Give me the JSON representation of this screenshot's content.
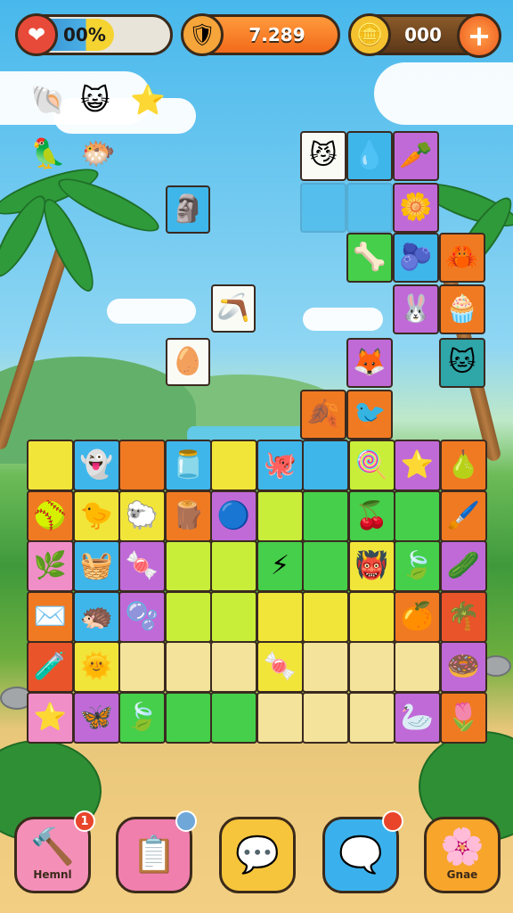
{
  "hud": {
    "progress": {
      "text": "00%",
      "fill_fraction": 0.62,
      "icon": "heart-icon"
    },
    "score": {
      "text": "7.289",
      "icon": "crest-icon"
    },
    "coins": {
      "text": "000",
      "icon": "coin-icon",
      "plus_symbol": "+"
    }
  },
  "colors": {
    "yellow": "#f2e53a",
    "lime": "#c8ee3a",
    "green": "#46cf4a",
    "orange": "#f07a22",
    "red": "#e9542a",
    "blue": "#3fb6ea",
    "purple": "#c06ad8",
    "pink": "#f08ec8",
    "white": "#fbfbf6",
    "sand": "#f4e39a",
    "teal": "#2fa6a8"
  },
  "floaters": [
    {
      "glyph": "🐚",
      "name": "shell-icon"
    },
    {
      "glyph": "😺",
      "name": "cat-face-icon"
    },
    {
      "glyph": "⭐",
      "name": "star-icon"
    },
    {
      "glyph": "🦜",
      "name": "parrot-icon"
    },
    {
      "glyph": "🐡",
      "name": "pufferfish-icon"
    }
  ],
  "falling_tiles": [
    {
      "glyph": "🗿",
      "color": "blue",
      "name": "moai-icon"
    },
    {
      "glyph": "🪃",
      "color": "white",
      "name": "boomerang-icon"
    },
    {
      "glyph": "🥚",
      "color": "white",
      "name": "egg-icon"
    }
  ],
  "stack_tiles": [
    {
      "glyph": "😼",
      "color": "white",
      "name": "cat-icon"
    },
    {
      "glyph": "💧",
      "color": "blue",
      "name": "drop-icon"
    },
    {
      "glyph": "🥕",
      "color": "purple",
      "name": "carrot-icon"
    },
    {
      "glyph": "",
      "color": "blue",
      "name": "empty-tile"
    },
    {
      "glyph": "",
      "color": "blue",
      "name": "empty-tile"
    },
    {
      "glyph": "🌼",
      "color": "purple",
      "name": "flower-icon"
    },
    {
      "glyph": "🦴",
      "color": "green",
      "name": "bone-icon"
    },
    {
      "glyph": "🫐",
      "color": "blue",
      "name": "berry-icon"
    },
    {
      "glyph": "🦀",
      "color": "orange",
      "name": "crab-icon"
    },
    {
      "glyph": "🐰",
      "color": "purple",
      "name": "bunny-icon"
    },
    {
      "glyph": "🧁",
      "color": "orange",
      "name": "cupcake-icon"
    },
    {
      "glyph": "🦊",
      "color": "purple",
      "name": "fox-icon"
    },
    {
      "glyph": "🐱",
      "color": "teal",
      "name": "kitty-icon"
    },
    {
      "glyph": "🍂",
      "color": "orange",
      "name": "leaf-icon"
    },
    {
      "glyph": "🐦",
      "color": "orange",
      "name": "bird-icon"
    }
  ],
  "board": [
    [
      {
        "color": "yellow",
        "glyph": ""
      },
      {
        "color": "blue",
        "glyph": "👻"
      },
      {
        "color": "orange",
        "glyph": ""
      },
      {
        "color": "blue",
        "glyph": "🫙"
      },
      {
        "color": "yellow",
        "glyph": ""
      },
      {
        "color": "blue",
        "glyph": "🐙"
      },
      {
        "color": "blue",
        "glyph": ""
      },
      {
        "color": "lime",
        "glyph": "🍭"
      },
      {
        "color": "purple",
        "glyph": "⭐"
      },
      {
        "color": "orange",
        "glyph": "🍐"
      }
    ],
    [
      {
        "color": "orange",
        "glyph": "🥎"
      },
      {
        "color": "yellow",
        "glyph": "🐤"
      },
      {
        "color": "yellow",
        "glyph": "🐑"
      },
      {
        "color": "orange",
        "glyph": "🪵"
      },
      {
        "color": "purple",
        "glyph": "🔵"
      },
      {
        "color": "lime",
        "glyph": ""
      },
      {
        "color": "green",
        "glyph": ""
      },
      {
        "color": "green",
        "glyph": "🍒"
      },
      {
        "color": "green",
        "glyph": ""
      },
      {
        "color": "orange",
        "glyph": "🖌️"
      }
    ],
    [
      {
        "color": "pink",
        "glyph": "🌿"
      },
      {
        "color": "blue",
        "glyph": "🧺"
      },
      {
        "color": "purple",
        "glyph": "🍬"
      },
      {
        "color": "lime",
        "glyph": ""
      },
      {
        "color": "lime",
        "glyph": ""
      },
      {
        "color": "green",
        "glyph": "⚡"
      },
      {
        "color": "green",
        "glyph": ""
      },
      {
        "color": "yellow",
        "glyph": "👹"
      },
      {
        "color": "green",
        "glyph": "🍃"
      },
      {
        "color": "purple",
        "glyph": "🥒"
      }
    ],
    [
      {
        "color": "orange",
        "glyph": "✉️"
      },
      {
        "color": "blue",
        "glyph": "🦔"
      },
      {
        "color": "purple",
        "glyph": "🫧"
      },
      {
        "color": "lime",
        "glyph": ""
      },
      {
        "color": "lime",
        "glyph": ""
      },
      {
        "color": "yellow",
        "glyph": ""
      },
      {
        "color": "yellow",
        "glyph": ""
      },
      {
        "color": "yellow",
        "glyph": ""
      },
      {
        "color": "orange",
        "glyph": "🍊"
      },
      {
        "color": "red",
        "glyph": "🌴"
      }
    ],
    [
      {
        "color": "red",
        "glyph": "🧪"
      },
      {
        "color": "yellow",
        "glyph": "🌞"
      },
      {
        "color": "sand",
        "glyph": ""
      },
      {
        "color": "sand",
        "glyph": ""
      },
      {
        "color": "sand",
        "glyph": ""
      },
      {
        "color": "yellow",
        "glyph": "🍬"
      },
      {
        "color": "sand",
        "glyph": ""
      },
      {
        "color": "sand",
        "glyph": ""
      },
      {
        "color": "sand",
        "glyph": ""
      },
      {
        "color": "purple",
        "glyph": "🍩"
      }
    ],
    [
      {
        "color": "pink",
        "glyph": "⭐"
      },
      {
        "color": "purple",
        "glyph": "🦋"
      },
      {
        "color": "green",
        "glyph": "🍃"
      },
      {
        "color": "green",
        "glyph": ""
      },
      {
        "color": "green",
        "glyph": ""
      },
      {
        "color": "sand",
        "glyph": ""
      },
      {
        "color": "sand",
        "glyph": ""
      },
      {
        "color": "sand",
        "glyph": ""
      },
      {
        "color": "purple",
        "glyph": "🦢"
      },
      {
        "color": "orange",
        "glyph": "🌷"
      }
    ]
  ],
  "bottom_bar": [
    {
      "name": "hammer-button",
      "icon": "🔨",
      "label": "Hemnl",
      "badge": "1",
      "bg": "#f48fb8",
      "badge_color": "#e8452b"
    },
    {
      "name": "notes-button",
      "icon": "📋",
      "label": "",
      "badge": "",
      "bg": "#f07fae",
      "badge_color": "#6fa7d9"
    },
    {
      "name": "chat-button",
      "icon": "💬",
      "label": "",
      "badge": "",
      "bg": "#f7c53b",
      "badge_color": ""
    },
    {
      "name": "message-button",
      "icon": "🗨️",
      "label": "",
      "badge": "",
      "bg": "#3ab1ec",
      "badge_color": "#e8452b"
    },
    {
      "name": "settings-button",
      "icon": "🌸",
      "label": "Gnae",
      "badge": "",
      "bg": "#f7a52b",
      "badge_color": ""
    }
  ]
}
